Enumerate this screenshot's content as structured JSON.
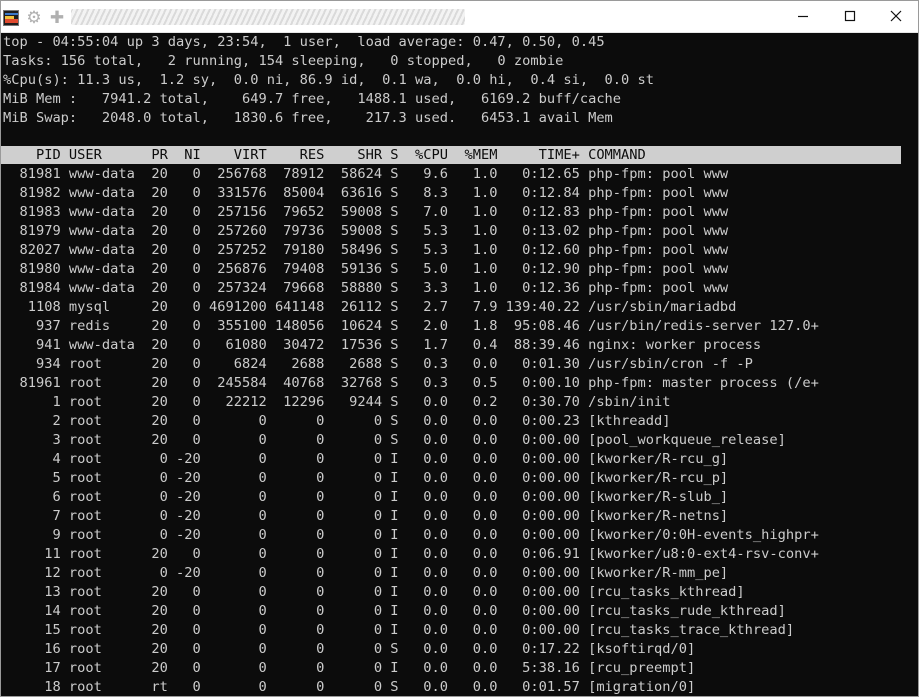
{
  "titlebar": {
    "icons": [
      "terminal-app-icon",
      "gear-icon",
      "new-tab-plus-icon"
    ],
    "gear_glyph": "⚙",
    "plus_glyph": "✚",
    "minimize_label": "minimize",
    "maximize_label": "maximize",
    "close_label": "close"
  },
  "summary": [
    "top - 04:55:04 up 3 days, 23:54,  1 user,  load average: 0.47, 0.50, 0.45",
    "Tasks: 156 total,   2 running, 154 sleeping,   0 stopped,   0 zombie",
    "%Cpu(s): 11.3 us,  1.2 sy,  0.0 ni, 86.9 id,  0.1 wa,  0.0 hi,  0.4 si,  0.0 st",
    "MiB Mem :   7941.2 total,    649.7 free,   1488.1 used,   6169.2 buff/cache",
    "MiB Swap:   2048.0 total,   1830.6 free,    217.3 used.   6453.1 avail Mem"
  ],
  "table_header": "    PID USER      PR  NI    VIRT    RES    SHR S  %CPU  %MEM     TIME+ COMMAND",
  "processes": [
    "  81981 www-data  20   0  256768  78912  58624 S   9.6   1.0   0:12.65 php-fpm: pool www",
    "  81982 www-data  20   0  331576  85004  63616 S   8.3   1.0   0:12.84 php-fpm: pool www",
    "  81983 www-data  20   0  257156  79652  59008 S   7.0   1.0   0:12.83 php-fpm: pool www",
    "  81979 www-data  20   0  257260  79736  59008 S   5.3   1.0   0:13.02 php-fpm: pool www",
    "  82027 www-data  20   0  257252  79180  58496 S   5.3   1.0   0:12.60 php-fpm: pool www",
    "  81980 www-data  20   0  256876  79408  59136 S   5.0   1.0   0:12.90 php-fpm: pool www",
    "  81984 www-data  20   0  257324  79668  58880 S   3.3   1.0   0:12.36 php-fpm: pool www",
    "   1108 mysql     20   0 4691200 641148  26112 S   2.7   7.9 139:40.22 /usr/sbin/mariadbd",
    "    937 redis     20   0  355100 148056  10624 S   2.0   1.8  95:08.46 /usr/bin/redis-server 127.0+",
    "    941 www-data  20   0   61080  30472  17536 S   1.7   0.4  88:39.46 nginx: worker process",
    "    934 root      20   0    6824   2688   2688 S   0.3   0.0   0:01.30 /usr/sbin/cron -f -P",
    "  81961 root      20   0  245584  40768  32768 S   0.3   0.5   0:00.10 php-fpm: master process (/e+",
    "      1 root      20   0   22212  12296   9244 S   0.0   0.2   0:30.70 /sbin/init",
    "      2 root      20   0       0      0      0 S   0.0   0.0   0:00.23 [kthreadd]",
    "      3 root      20   0       0      0      0 S   0.0   0.0   0:00.00 [pool_workqueue_release]",
    "      4 root       0 -20       0      0      0 I   0.0   0.0   0:00.00 [kworker/R-rcu_g]",
    "      5 root       0 -20       0      0      0 I   0.0   0.0   0:00.00 [kworker/R-rcu_p]",
    "      6 root       0 -20       0      0      0 I   0.0   0.0   0:00.00 [kworker/R-slub_]",
    "      7 root       0 -20       0      0      0 I   0.0   0.0   0:00.00 [kworker/R-netns]",
    "      9 root       0 -20       0      0      0 I   0.0   0.0   0:00.00 [kworker/0:0H-events_highpr+",
    "     11 root      20   0       0      0      0 I   0.0   0.0   0:06.91 [kworker/u8:0-ext4-rsv-conv+",
    "     12 root       0 -20       0      0      0 I   0.0   0.0   0:00.00 [kworker/R-mm_pe]",
    "     13 root      20   0       0      0      0 I   0.0   0.0   0:00.00 [rcu_tasks_kthread]",
    "     14 root      20   0       0      0      0 I   0.0   0.0   0:00.00 [rcu_tasks_rude_kthread]",
    "     15 root      20   0       0      0      0 I   0.0   0.0   0:00.00 [rcu_tasks_trace_kthread]",
    "     16 root      20   0       0      0      0 S   0.0   0.0   0:17.22 [ksoftirqd/0]",
    "     17 root      20   0       0      0      0 I   0.0   0.0   5:38.16 [rcu_preempt]",
    "     18 root      rt   0       0      0      0 S   0.0   0.0   0:01.57 [migration/0]"
  ]
}
